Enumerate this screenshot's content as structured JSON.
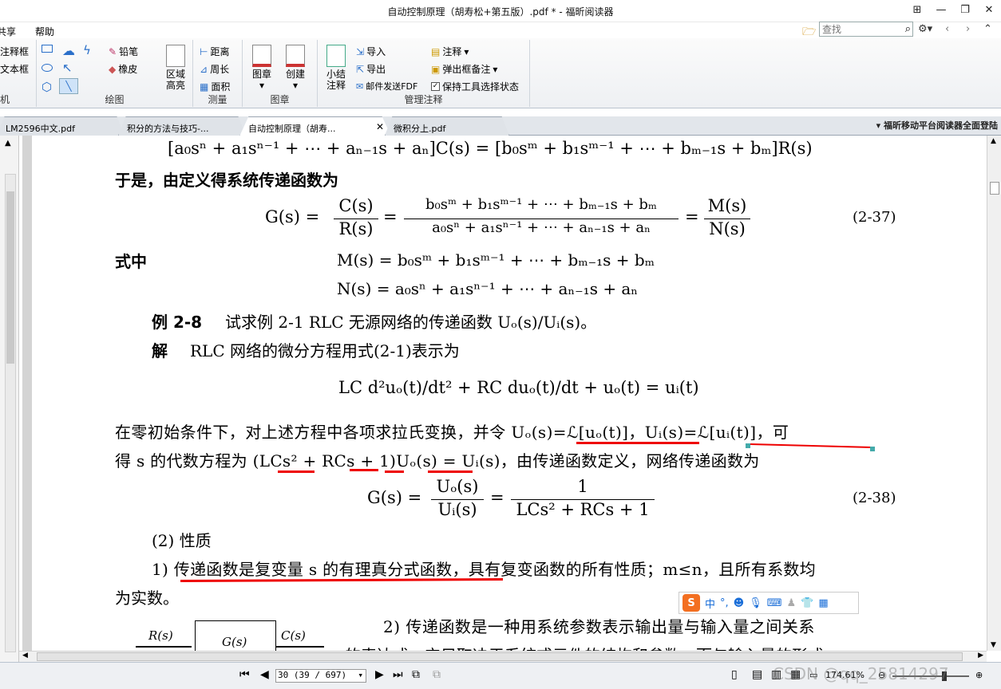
{
  "window": {
    "title": "自动控制原理（胡寿松+第五版）.pdf * - 福昕阅读器"
  },
  "menu": {
    "share": "共享",
    "help": "帮助"
  },
  "search": {
    "placeholder": "查找"
  },
  "ribbon": {
    "g1": {
      "items": [
        "注释框",
        "文本框"
      ],
      "label": "机"
    },
    "g2": {
      "items": [
        "铅笔",
        "橡皮"
      ],
      "label": "绘图"
    },
    "g3": {
      "area_highlight": "区域\n高亮"
    },
    "g4": {
      "items": [
        "距离",
        "周长",
        "面积"
      ],
      "label": "测量"
    },
    "g5": {
      "stamp": "图章",
      "create": "创建",
      "label": "图章"
    },
    "g6": {
      "summary": "小结\n注释",
      "import": "导入",
      "export": "导出",
      "email": "邮件发送FDF",
      "note": "注释",
      "popup": "弹出框备注",
      "keep": "保持工具选择状态",
      "label": "管理注释"
    }
  },
  "tabs": [
    {
      "label": "LM2596中文.pdf"
    },
    {
      "label": "积分的方法与技巧-..."
    },
    {
      "label": "自动控制原理（胡寿..."
    },
    {
      "label": "微积分上.pdf"
    }
  ],
  "ad": "福昕移动平台阅读器全面登陆",
  "doc": {
    "l1": "[a₀sⁿ + a₁sⁿ⁻¹ + ⋯ + aₙ₋₁s + aₙ]C(s) = [b₀sᵐ + b₁sᵐ⁻¹ + ⋯ + bₘ₋₁s + bₘ]R(s)",
    "l2": "于是，由定义得系统传递函数为",
    "eq237_lhs": "G(s) =",
    "eq237_f1n": "C(s)",
    "eq237_f1d": "R(s)",
    "eq237_f2n": "b₀sᵐ + b₁sᵐ⁻¹ + ⋯ + bₘ₋₁s + bₘ",
    "eq237_f2d": "a₀sⁿ + a₁sⁿ⁻¹ + ⋯ + aₙ₋₁s + aₙ",
    "eq237_f3n": "M(s)",
    "eq237_f3d": "N(s)",
    "eq237_num": "(2-37)",
    "shizhong": "式中",
    "m_eq": "M(s) = b₀sᵐ + b₁sᵐ⁻¹ + ⋯ + bₘ₋₁s + bₘ",
    "n_eq": "N(s) = a₀sⁿ + a₁sⁿ⁻¹ + ⋯ + aₙ₋₁s + aₙ",
    "ex_label": "例 2-8",
    "ex_text": "试求例 2-1 RLC 无源网络的传递函数 Uₒ(s)/Uᵢ(s)。",
    "sol_label": "解",
    "sol_text": "RLC 网络的微分方程用式(2-1)表示为",
    "diff_eq": "LC d²uₒ(t)/dt² + RC duₒ(t)/dt + uₒ(t) = uᵢ(t)",
    "p1": "在零初始条件下，对上述方程中各项求拉氏变换，并令 Uₒ(s)=ℒ[uₒ(t)]，Uᵢ(s)=ℒ[uᵢ(t)]，可",
    "p2": "得 s 的代数方程为 (LCs² + RCs + 1)Uₒ(s) = Uᵢ(s)，由传递函数定义，网络传递函数为",
    "eq238_lhs": "G(s) =",
    "eq238_f1n": "Uₒ(s)",
    "eq238_f1d": "Uᵢ(s)",
    "eq238_f2n": "1",
    "eq238_f2d": "LCs² + RCs + 1",
    "eq238_num": "(2-38)",
    "sec": "(2) 性质",
    "prop1a": "1) 传递函数是复变量 s 的有理真分式函数，具有复变函数的所有性质；m≤n，且所有系数均",
    "prop1b": "为实数。",
    "prop2": "2) 传递函数是一种用系统参数表示输出量与输入量之间关系",
    "prop2b": "的表达式，它只取决于系统或元件的结构和参数，而与输入量的形式",
    "blk_in": "R(s)",
    "blk_g": "G(s)",
    "blk_out": "C(s)"
  },
  "ime": {
    "lang": "中"
  },
  "status": {
    "page_input": "30 (39 / 697)",
    "zoom": "174.61%",
    "watermark": "CSDN @qq_25814297"
  }
}
